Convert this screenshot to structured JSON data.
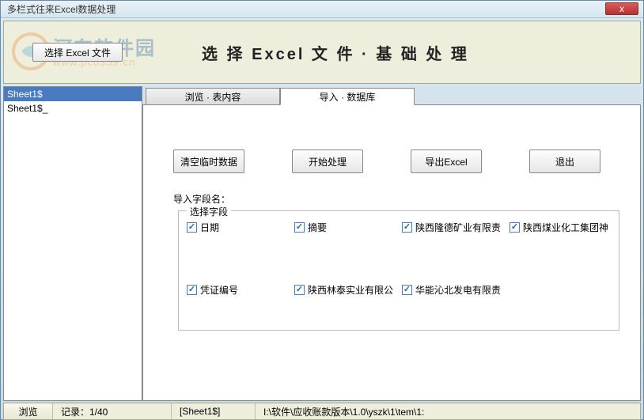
{
  "window": {
    "title": "多栏式往来Excel数据处理",
    "close_icon": "x"
  },
  "header": {
    "select_file_btn": "选择 Excel 文件",
    "title": "选 择  Excel  文 件 · 基 础 处 理"
  },
  "watermark": {
    "brand": "河东软件园",
    "url": "www.pc0359.cn"
  },
  "sidebar": {
    "items": [
      {
        "label": "Sheet1$",
        "selected": true
      },
      {
        "label": "Sheet1$_",
        "selected": false
      }
    ]
  },
  "tabs": [
    {
      "label": "浏览 · 表内容",
      "active": false
    },
    {
      "label": "导入 · 数据库",
      "active": true
    }
  ],
  "actions": {
    "clear_temp": "清空临时数据",
    "start": "开始处理",
    "export": "导出Excel",
    "exit": "退出"
  },
  "fields": {
    "title": "导入字段名：",
    "legend": "选择字段",
    "items": [
      {
        "label": "日期",
        "checked": true
      },
      {
        "label": "摘要",
        "checked": true
      },
      {
        "label": "陕西隆德矿业有限责",
        "checked": true
      },
      {
        "label": "陕西煤业化工集团神",
        "checked": true
      },
      {
        "label": "凭证编号",
        "checked": true
      },
      {
        "label": "陕西林泰实业有限公",
        "checked": true
      },
      {
        "label": "华能沁北发电有限责",
        "checked": true
      }
    ]
  },
  "status": {
    "browse": "浏览",
    "record": "记录：1/40",
    "sheet": "[Sheet1$]",
    "path": "I:\\软件\\应收账款版本\\1.0\\yszk\\1\\tem\\1:"
  }
}
